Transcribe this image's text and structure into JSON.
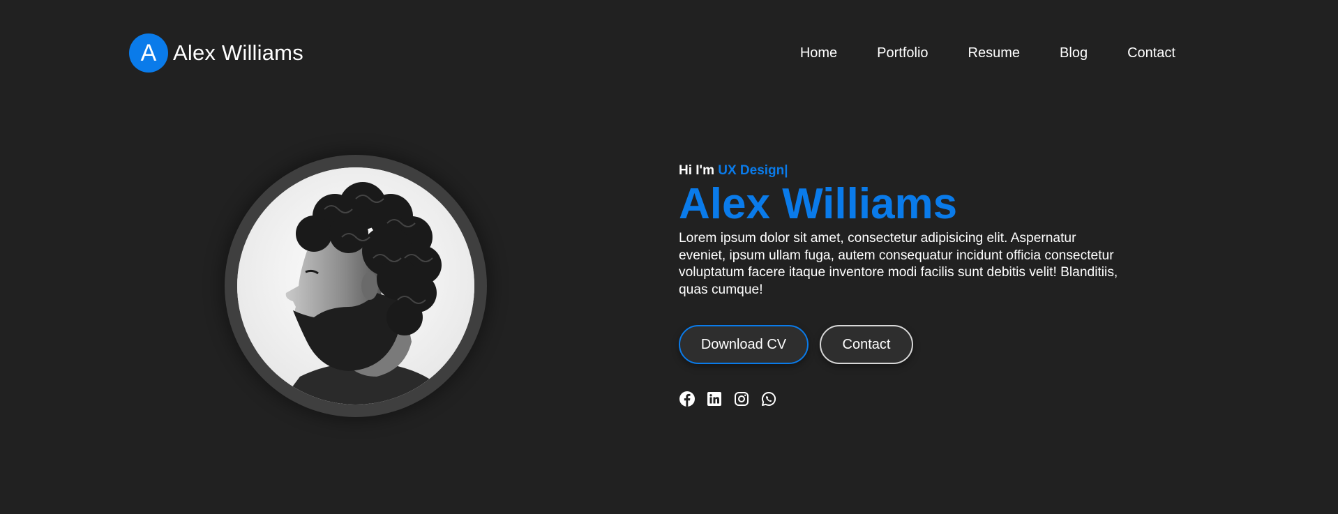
{
  "brand": {
    "logo_letter": "A",
    "name": "Alex Williams"
  },
  "nav": {
    "items": [
      {
        "label": "Home"
      },
      {
        "label": "Portfolio"
      },
      {
        "label": "Resume"
      },
      {
        "label": "Blog"
      },
      {
        "label": "Contact"
      }
    ]
  },
  "hero": {
    "greeting_prefix": "Hi I'm ",
    "role": "UX Design|",
    "name": "Alex Williams",
    "description": "Lorem ipsum dolor sit amet, consectetur adipisicing elit. Aspernatur eveniet, ipsum ullam fuga, autem consequatur incidunt officia consectetur voluptatum facere itaque inventore modi facilis sunt debitis velit! Blanditiis, quas cumque!",
    "buttons": {
      "download_label": "Download CV",
      "contact_label": "Contact"
    },
    "socials": [
      "facebook-icon",
      "linkedin-icon",
      "instagram-icon",
      "whatsapp-icon"
    ]
  },
  "colors": {
    "background": "#212121",
    "accent": "#0a7bea",
    "button_bg": "#2e2e2e",
    "avatar_ring": "#3f3f3f"
  }
}
